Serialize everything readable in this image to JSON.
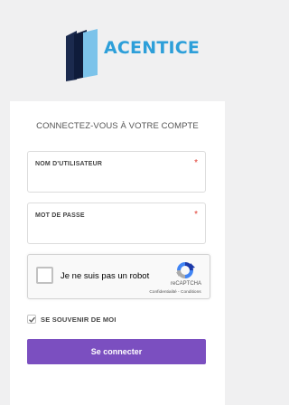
{
  "brand": {
    "name": "ACENTICE",
    "colors": {
      "logo_text": "#2d9fd9",
      "accent": "#7b4fc0",
      "required": "#e03c31"
    }
  },
  "login": {
    "heading": "CONNECTEZ-VOUS À VOTRE COMPTE",
    "username": {
      "label": "NOM D'UTILISATEUR",
      "required_mark": "*",
      "value": "",
      "icon": "none"
    },
    "password": {
      "label": "MOT DE PASSE",
      "required_mark": "*",
      "value": ""
    },
    "captcha": {
      "label": "Je ne suis pas un robot",
      "brand": "reCAPTCHA",
      "links": "Confidentialité - Conditions",
      "checked": false,
      "icon": "recaptcha-icon"
    },
    "remember": {
      "label": "SE SOUVENIR DE MOI",
      "checked": true,
      "icon": "checkmark-icon"
    },
    "submit_label": "Se connecter"
  }
}
